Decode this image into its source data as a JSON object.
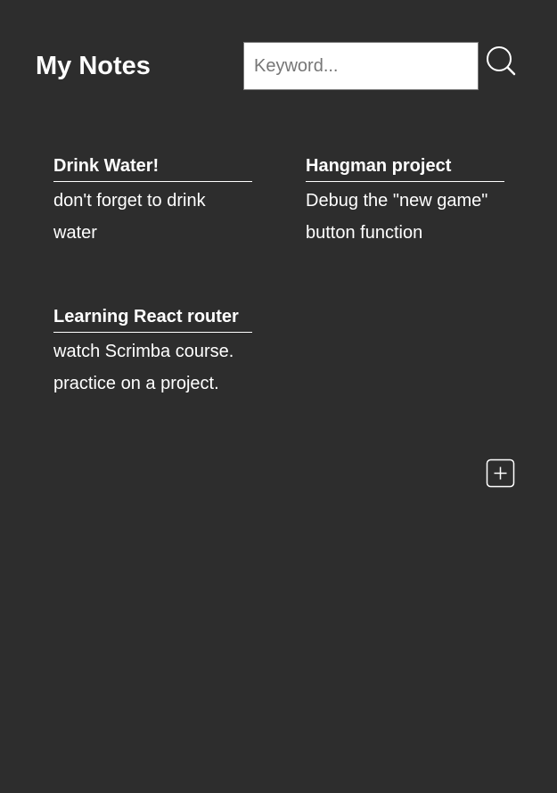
{
  "app": {
    "title": "My Notes"
  },
  "search": {
    "placeholder": "Keyword...",
    "value": "",
    "icon": "search-icon"
  },
  "notes": [
    {
      "title": "Drink Water!",
      "body": "don't forget to drink water"
    },
    {
      "title": "Hangman project",
      "body": "Debug the \"new game\" button function"
    },
    {
      "title": "Learning React router",
      "body": "watch Scrimba course. practice on a project."
    }
  ],
  "add_note": {
    "icon": "plus-square-icon"
  },
  "theme": {
    "background": "#2d2d2d",
    "text": "#ffffff"
  }
}
